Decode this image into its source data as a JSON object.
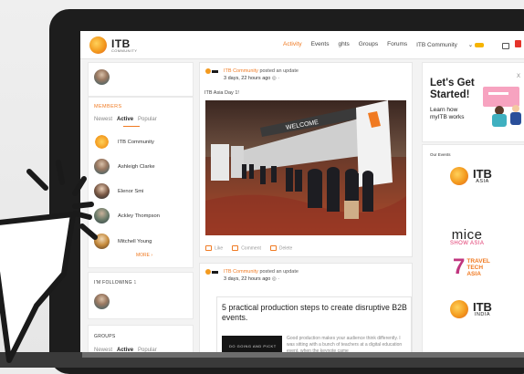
{
  "nav": {
    "logo_title": "ITB",
    "logo_sub": "COMMUNITY",
    "links": [
      "Activity",
      "Events",
      "ghts",
      "Groups",
      "Forums",
      "ITB Community"
    ],
    "active_index": 0,
    "brand_color": "#f07a22"
  },
  "members": {
    "title": "MEMBERS",
    "tabs": [
      "Newest",
      "Active",
      "Popular"
    ],
    "selected_tab": "Active",
    "list": [
      "ITB Community",
      "Ashleigh Clarke",
      "Elenor Smi",
      "Ackley Thompson",
      "Mitchell Young"
    ],
    "more": "MORE"
  },
  "following": {
    "title": "I'M FOLLOWING",
    "count": "1"
  },
  "groups": {
    "title": "GROUPS",
    "tabs": [
      "Newest",
      "Active",
      "Popular"
    ]
  },
  "posts": [
    {
      "author": "ITB Community",
      "action": "posted an update",
      "time": "3 days, 22 hours ago",
      "caption": "ITB Asia Day 1!",
      "banner": "WELCOME",
      "actions": [
        "Like",
        "Comment",
        "Delete"
      ]
    },
    {
      "author": "ITB Community",
      "action": "posted an update",
      "time": "3 days, 22 hours ago",
      "article_title": "5 practical production steps to create disruptive B2B events.",
      "article_excerpt": "Good production makes your audience think differently. I was sitting with a bunch of teachers at a digital education event, when the keynote came",
      "thumb_text": "DO GOING AND PICKT"
    }
  ],
  "get_started": {
    "title_line1": "Let's Get",
    "title_line2": "Started!",
    "sub_line1": "Learn how",
    "sub_line2": "myITB works",
    "close": "X"
  },
  "events": {
    "title": "Our Events",
    "items": [
      {
        "name": "ITB",
        "sub": "ASIA"
      },
      {
        "name": "mice",
        "sub": "SHOW ASIA"
      },
      {
        "name": "TRAVEL TECH ASIA",
        "sub": ""
      },
      {
        "name": "ITB",
        "sub": "INDIA"
      }
    ]
  }
}
